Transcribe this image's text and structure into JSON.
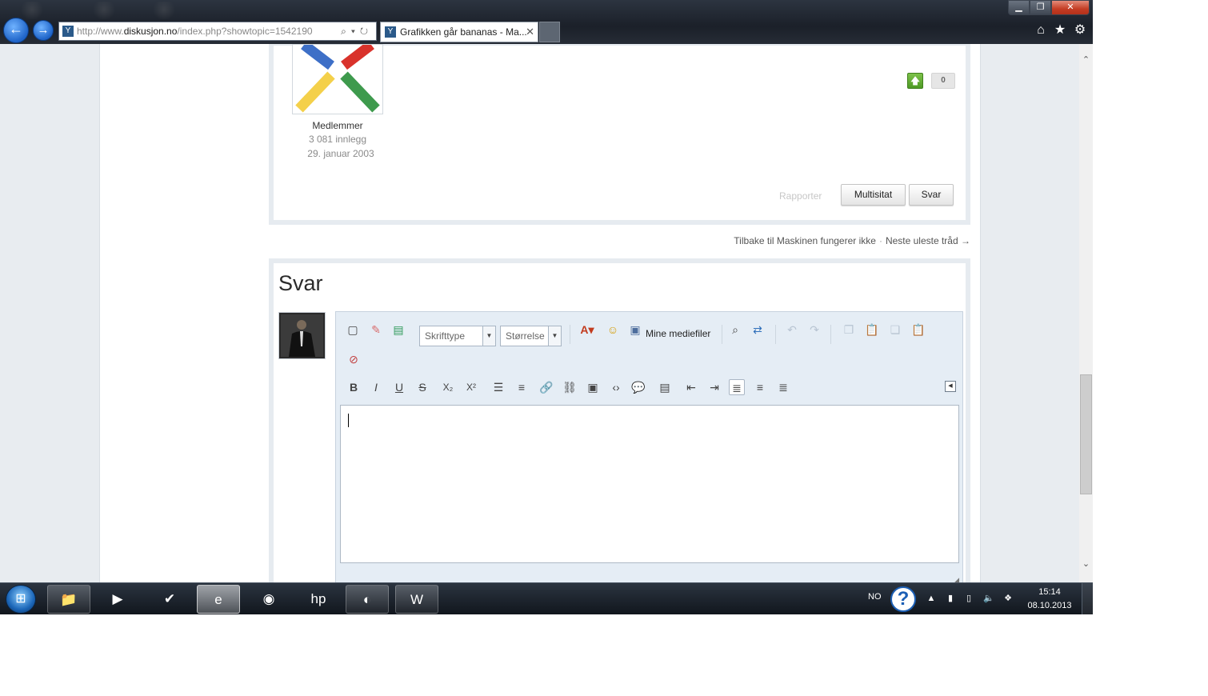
{
  "browser": {
    "url_prefix": "http://www.",
    "url_domain": "diskusjon.no",
    "url_path": "/index.php?showtopic=1542190",
    "tab_title": "Grafikken går bananas - Ma...",
    "tab_close": "✕",
    "back_glyph": "←",
    "forward_glyph": "→",
    "address_actions": "⌕▾↻",
    "favicon_glyph": "Y",
    "home_glyph": "⌂",
    "star_glyph": "★",
    "gear_glyph": "⚙",
    "minimize_glyph": "▁",
    "restore_glyph": "❐",
    "close_glyph": "✕"
  },
  "post": {
    "author_group": "Medlemmer",
    "author_posts": "3 081 innlegg",
    "author_joined": "29. januar 2003",
    "vote_up_glyph": "🡅",
    "vote_count": "0",
    "report_label": "Rapporter",
    "multiquote_label": "Multisitat",
    "reply_label": "Svar"
  },
  "thread_nav": {
    "back_link": "Tilbake til Maskinen fungerer ikke",
    "separator": "·",
    "next_link": "Neste uleste tråd →"
  },
  "reply": {
    "title": "Svar",
    "font_select": "Skrifttype",
    "size_select": "Størrelse",
    "media_label": "Mine mediefiler",
    "toolbar_row3": [
      {
        "name": "bold-button",
        "glyph": "B"
      },
      {
        "name": "italic-button",
        "glyph": "I"
      },
      {
        "name": "underline-button",
        "glyph": "U"
      },
      {
        "name": "strikethrough-button",
        "glyph": "S"
      },
      {
        "name": "subscript-button",
        "glyph": "X₂"
      },
      {
        "name": "superscript-button",
        "glyph": "X²"
      },
      {
        "name": "bulleted-list-button",
        "glyph": "☰"
      },
      {
        "name": "numbered-list-button",
        "glyph": "≡"
      },
      {
        "name": "link-button",
        "glyph": "🔗"
      },
      {
        "name": "unlink-button",
        "glyph": "⛓"
      },
      {
        "name": "image-button",
        "glyph": "▣"
      },
      {
        "name": "code-button",
        "glyph": "‹›"
      },
      {
        "name": "quote-button",
        "glyph": "💬"
      },
      {
        "name": "spoiler-button",
        "glyph": "▤"
      },
      {
        "name": "outdent-button",
        "glyph": "⇤"
      },
      {
        "name": "indent-button",
        "glyph": "⇥"
      },
      {
        "name": "align-left-button",
        "glyph": "≣"
      },
      {
        "name": "align-center-button",
        "glyph": "≡"
      },
      {
        "name": "align-right-button",
        "glyph": "≣"
      }
    ]
  },
  "taskbar": {
    "start_glyph": "⊞",
    "lang": "NO",
    "help_glyph": "?",
    "time": "15:14",
    "date": "08.10.2013",
    "tray_glyphs": {
      "up": "▲",
      "signal": "▮",
      "battery": "▯",
      "volume": "🔈",
      "dropbox": "❖"
    },
    "apps": [
      {
        "name": "explorer-task",
        "glyph": "📁"
      },
      {
        "name": "media-player-task",
        "glyph": "▶"
      },
      {
        "name": "tasks-app-task",
        "glyph": "✔"
      },
      {
        "name": "internet-explorer-task",
        "glyph": "e"
      },
      {
        "name": "chrome-task",
        "glyph": "◉"
      },
      {
        "name": "hp-task",
        "glyph": "hp"
      },
      {
        "name": "bittorrent-task",
        "glyph": "◐"
      },
      {
        "name": "word-task",
        "glyph": "W"
      }
    ]
  },
  "colors": {
    "accent_blue": "#1f64c8",
    "vote_green": "#4e9a25",
    "page_bg": "#e8ecf0",
    "editor_bg": "#e5edf5"
  }
}
